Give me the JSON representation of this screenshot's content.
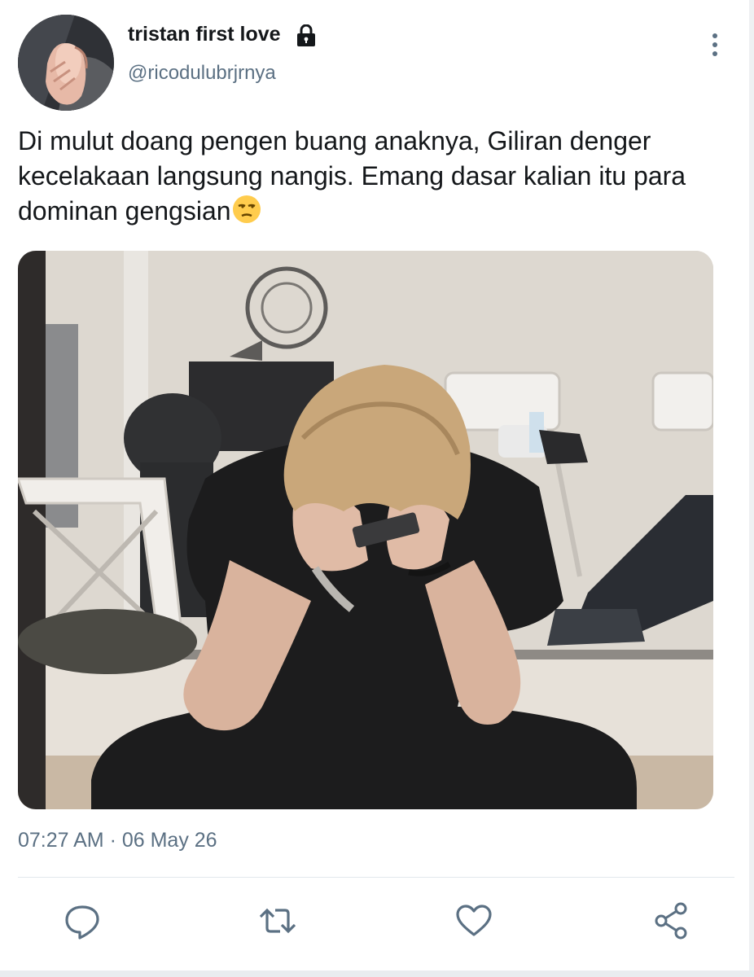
{
  "tweet": {
    "author": {
      "display_name": "tristan first love",
      "handle": "@ricodulubrjrnya",
      "locked": true
    },
    "text": "Di mulut doang pengen buang anaknya, Giliran denger kecelakaan langsung nangis. Emang dasar kalian itu para dominan gengsian",
    "emoji": "unamused-face",
    "media": {
      "type": "photo",
      "alt": ""
    },
    "timestamp": "07:27 AM · 06 May 26"
  },
  "actions": [
    {
      "name": "reply",
      "icon": "reply-icon"
    },
    {
      "name": "retweet",
      "icon": "retweet-icon"
    },
    {
      "name": "like",
      "icon": "heart-icon"
    },
    {
      "name": "share",
      "icon": "share-icon"
    }
  ],
  "colors": {
    "text": "#14171a",
    "secondary": "#5b7083",
    "divider": "#e1e8ed"
  }
}
